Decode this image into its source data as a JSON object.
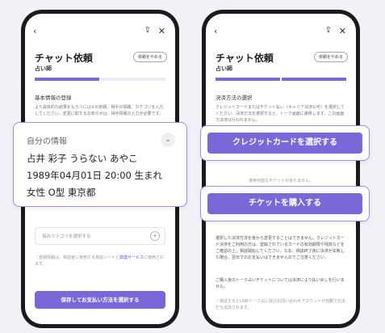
{
  "left": {
    "title": "チャット依頼",
    "subtitle": "占い師",
    "stop_label": "依頼をやめる",
    "section_title": "基本情報の登録",
    "description": "より具体的な結果をもらうには②の依頼、相手の情報、カテゴリを入力してください。変更に関するお知らせは、相手情報の入力が必要です。",
    "category_placeholder": "悩みカテゴリを選択する",
    "consent_prefix": "・登録情報は、相談者に使用する相談シートと",
    "consent_link": "関連サービス",
    "consent_suffix": "に使用されます。",
    "cta_label": "保存してお支払い方法を選択する"
  },
  "info_card": {
    "label": "自分の情報",
    "name_line": "占井 彩子 うらない あやこ",
    "birth_line": "1989年04月01日 20:00 生まれ",
    "profile_line": "女性 O型 東京都"
  },
  "right": {
    "title": "チャット依頼",
    "subtitle": "占い師",
    "stop_label": "依頼をやめる",
    "section_title": "決済方法の選択",
    "description": "クレジットカードまたはチケット払い（キャリア決済も可）を選択してください。決済方法を選択すると、トーク画面に遷移します。この画面で決済は行われません。",
    "no_ticket": "使用可能なチケットがありません。",
    "notes_1": "選択した決済方法を後から変更することはできません。クレジットカード決済をご利用の方は、登録されているカードの有効期限や残高などをご確認の上、相談開始してください。なお、相談終了後に決済が失敗した場合、翌日でのお支払いはできませんのでご注意ください。",
    "notes_2": "ご購入後のトーク占いチケットについては決済により払い戻しを行いません。",
    "footer_note": "・検証するとLINEトーク占い及びお問い合わせアカウントが自動でお友だち追加されます。"
  },
  "buttons": {
    "credit": "クレジットカードを選択する",
    "ticket": "チケットを購入する"
  }
}
